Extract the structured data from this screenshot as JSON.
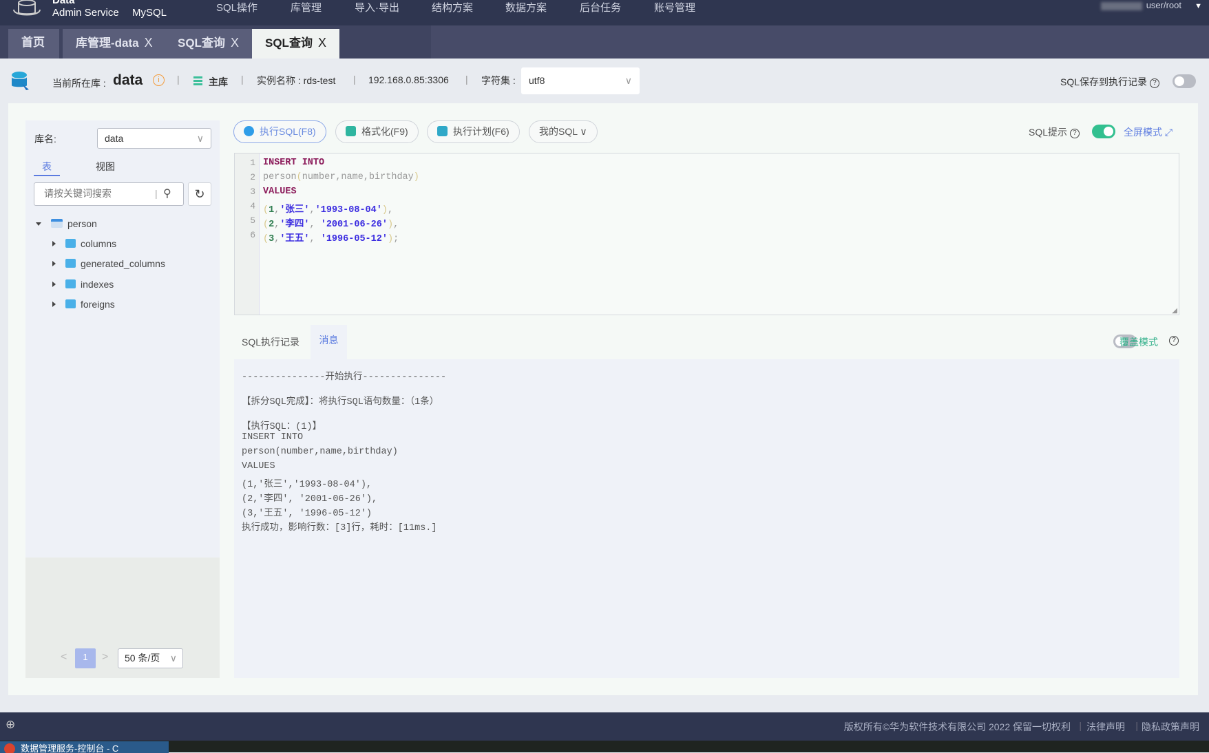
{
  "topbar": {
    "brand_line1": "Data",
    "brand_line2": "Admin Service",
    "engine": "MySQL",
    "nav": [
      "SQL操作",
      "库管理",
      "导入·导出",
      "结构方案",
      "数据方案",
      "后台任务",
      "账号管理"
    ],
    "user": "user/root"
  },
  "tabs": [
    {
      "label": "首页",
      "closable": false
    },
    {
      "label": "库管理-data",
      "closable": true
    },
    {
      "label": "SQL查询",
      "closable": true
    },
    {
      "label": "SQL查询",
      "closable": true,
      "active": true
    }
  ],
  "close_glyph": "X",
  "info": {
    "current_db_label": "当前所在库 :",
    "current_db": "data",
    "role": "主库",
    "instance_label": "实例名称 : rds-test",
    "address": "192.168.0.85:3306",
    "charset_label": "字符集 :",
    "charset": "utf8",
    "save_label": "SQL保存到执行记录",
    "save_enabled": false
  },
  "sidebar": {
    "db_label": "库名:",
    "db_value": "data",
    "tabs": [
      "表",
      "视图"
    ],
    "search_placeholder": "请按关键词搜索",
    "tree": {
      "table": "person",
      "children": [
        "columns",
        "generated_columns",
        "indexes",
        "foreigns"
      ]
    },
    "pagination": {
      "page": "1",
      "page_size": "50 条/页"
    }
  },
  "toolbar": {
    "execute": "执行SQL(F8)",
    "format": "格式化(F9)",
    "plan": "执行计划(F6)",
    "my_sql": "我的SQL",
    "hint_label": "SQL提示",
    "hint_enabled": true,
    "fullscreen": "全屏模式"
  },
  "editor": {
    "lines": [
      [
        {
          "t": "INSERT INTO",
          "c": "kw"
        }
      ],
      [
        {
          "t": "person",
          "c": "id"
        },
        {
          "t": "(",
          "c": "pn"
        },
        {
          "t": "number,name,birthday",
          "c": "id"
        },
        {
          "t": ")",
          "c": "pn"
        }
      ],
      [
        {
          "t": "VALUES",
          "c": "kw"
        }
      ],
      [
        {
          "t": "(",
          "c": "pn"
        },
        {
          "t": "1",
          "c": "num"
        },
        {
          "t": ",",
          "c": "pu"
        },
        {
          "t": "'张三'",
          "c": "str"
        },
        {
          "t": ",",
          "c": "pu"
        },
        {
          "t": "'1993-08-04'",
          "c": "str"
        },
        {
          "t": ")",
          "c": "pn"
        },
        {
          "t": ",",
          "c": "pu"
        }
      ],
      [
        {
          "t": "(",
          "c": "pn"
        },
        {
          "t": "2",
          "c": "num"
        },
        {
          "t": ",",
          "c": "pu"
        },
        {
          "t": "'李四'",
          "c": "str"
        },
        {
          "t": ", ",
          "c": "pu"
        },
        {
          "t": "'2001-06-26'",
          "c": "str"
        },
        {
          "t": ")",
          "c": "pn"
        },
        {
          "t": ",",
          "c": "pu"
        }
      ],
      [
        {
          "t": "(",
          "c": "pn"
        },
        {
          "t": "3",
          "c": "num"
        },
        {
          "t": ",",
          "c": "pu"
        },
        {
          "t": "'王五'",
          "c": "str"
        },
        {
          "t": ", ",
          "c": "pu"
        },
        {
          "t": "'1996-05-12'",
          "c": "str"
        },
        {
          "t": ")",
          "c": "pn"
        },
        {
          "t": ";",
          "c": "pu"
        }
      ]
    ]
  },
  "result_tabs": {
    "history": "SQL执行记录",
    "messages": "消息",
    "overwrite_label": "覆盖模式",
    "overwrite_enabled": false
  },
  "messages": [
    "---------------开始执行---------------",
    "【拆分SQL完成】：将执行SQL语句数量：（1条）",
    "【执行SQL：(1)】",
    "INSERT INTO",
    "person(number,name,birthday)",
    "VALUES",
    "(1,'张三','1993-08-04'),",
    "(2,'李四', '2001-06-26'),",
    "(3,'王五', '1996-05-12')",
    "执行成功，影响行数：[3]行，耗时：[11ms.]"
  ],
  "footer": {
    "copyright": "版权所有©华为软件技术有限公司 2022 保留一切权利",
    "legal": "法律声明",
    "privacy": "隐私政策声明"
  },
  "taskbar": {
    "window": "数据管理服务-控制台 - C"
  }
}
